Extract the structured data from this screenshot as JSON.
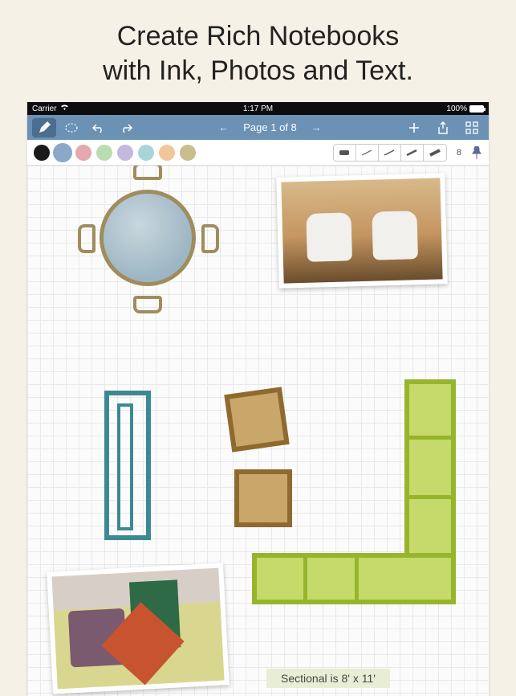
{
  "promo": {
    "line1": "Create Rich Notebooks",
    "line2": "with Ink, Photos and Text."
  },
  "status_bar": {
    "carrier": "Carrier",
    "time": "1:17 PM",
    "battery_percent": "100%"
  },
  "toolbar": {
    "pen_tool": "pen-tool",
    "lasso_tool": "lasso-select",
    "undo": "undo",
    "redo": "redo",
    "prev_page": "←",
    "page_indicator": "Page 1 of 8",
    "next_page": "→",
    "add": "add",
    "share": "share",
    "grid_view": "grid-view"
  },
  "palette": {
    "colors": [
      {
        "name": "black",
        "hex": "#1a1a1a",
        "selected": false
      },
      {
        "name": "blue",
        "hex": "#8aa9c8",
        "selected": true
      },
      {
        "name": "pink",
        "hex": "#e3a8b0",
        "selected": false
      },
      {
        "name": "green",
        "hex": "#b9dcb0",
        "selected": false
      },
      {
        "name": "purple",
        "hex": "#c5b8e0",
        "selected": false
      },
      {
        "name": "teal",
        "hex": "#a9d5d8",
        "selected": false
      },
      {
        "name": "orange",
        "hex": "#f0c79a",
        "selected": false
      },
      {
        "name": "tan",
        "hex": "#c7bd8f",
        "selected": false
      }
    ],
    "pens": [
      "eraser",
      "thin",
      "thin",
      "medium",
      "thick"
    ],
    "page_number": "8",
    "pin": "pin"
  },
  "canvas": {
    "note_text": "Sectional is 8' x 11'",
    "shapes": {
      "table": "round-table-with-4-chairs",
      "cabinet": "tall-cabinet",
      "boxes": "two-ottomans",
      "sectional": "l-shaped-sectional"
    },
    "photos": {
      "chairs": "white-bar-stools-photo",
      "couch": "couch-with-pillows-photo"
    }
  }
}
